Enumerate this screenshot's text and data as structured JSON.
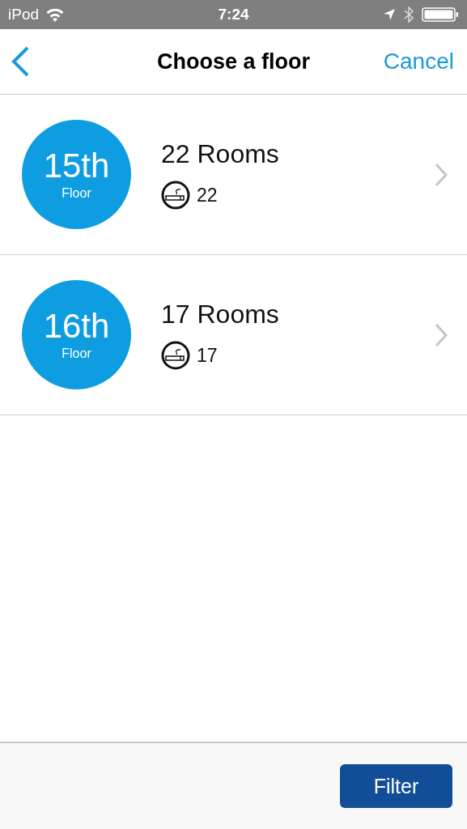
{
  "status_bar": {
    "carrier": "iPod",
    "time": "7:24"
  },
  "nav": {
    "title": "Choose a floor",
    "cancel": "Cancel"
  },
  "floors": [
    {
      "number": "15th",
      "label": "Floor",
      "rooms": "22 Rooms",
      "smoking_count": "22"
    },
    {
      "number": "16th",
      "label": "Floor",
      "rooms": "17 Rooms",
      "smoking_count": "17"
    }
  ],
  "footer": {
    "button": "Filter"
  }
}
